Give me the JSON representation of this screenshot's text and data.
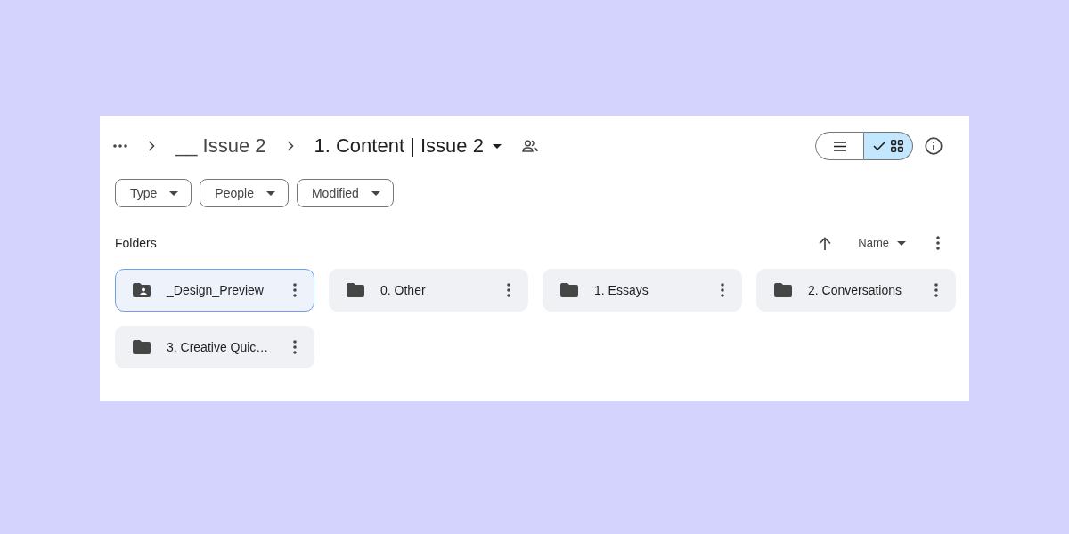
{
  "breadcrumb": [
    {
      "label": "__ Issue 2",
      "current": false
    },
    {
      "label": "1. Content | Issue 2",
      "current": true
    }
  ],
  "view_toggle": [
    {
      "kind": "list",
      "selected": false
    },
    {
      "kind": "grid",
      "selected": true
    }
  ],
  "filters": [
    {
      "label": "Type"
    },
    {
      "label": "People"
    },
    {
      "label": "Modified"
    }
  ],
  "section": {
    "title": "Folders",
    "sort_label": "Name"
  },
  "folders": [
    {
      "name": "_Design_Preview",
      "kind": "shared",
      "selected": true
    },
    {
      "name": "0. Other",
      "kind": "folder",
      "selected": false
    },
    {
      "name": "1. Essays",
      "kind": "folder",
      "selected": false
    },
    {
      "name": "2. Conversations",
      "kind": "folder",
      "selected": false
    },
    {
      "name": "3. Creative Quic…",
      "kind": "folder",
      "selected": false
    }
  ]
}
